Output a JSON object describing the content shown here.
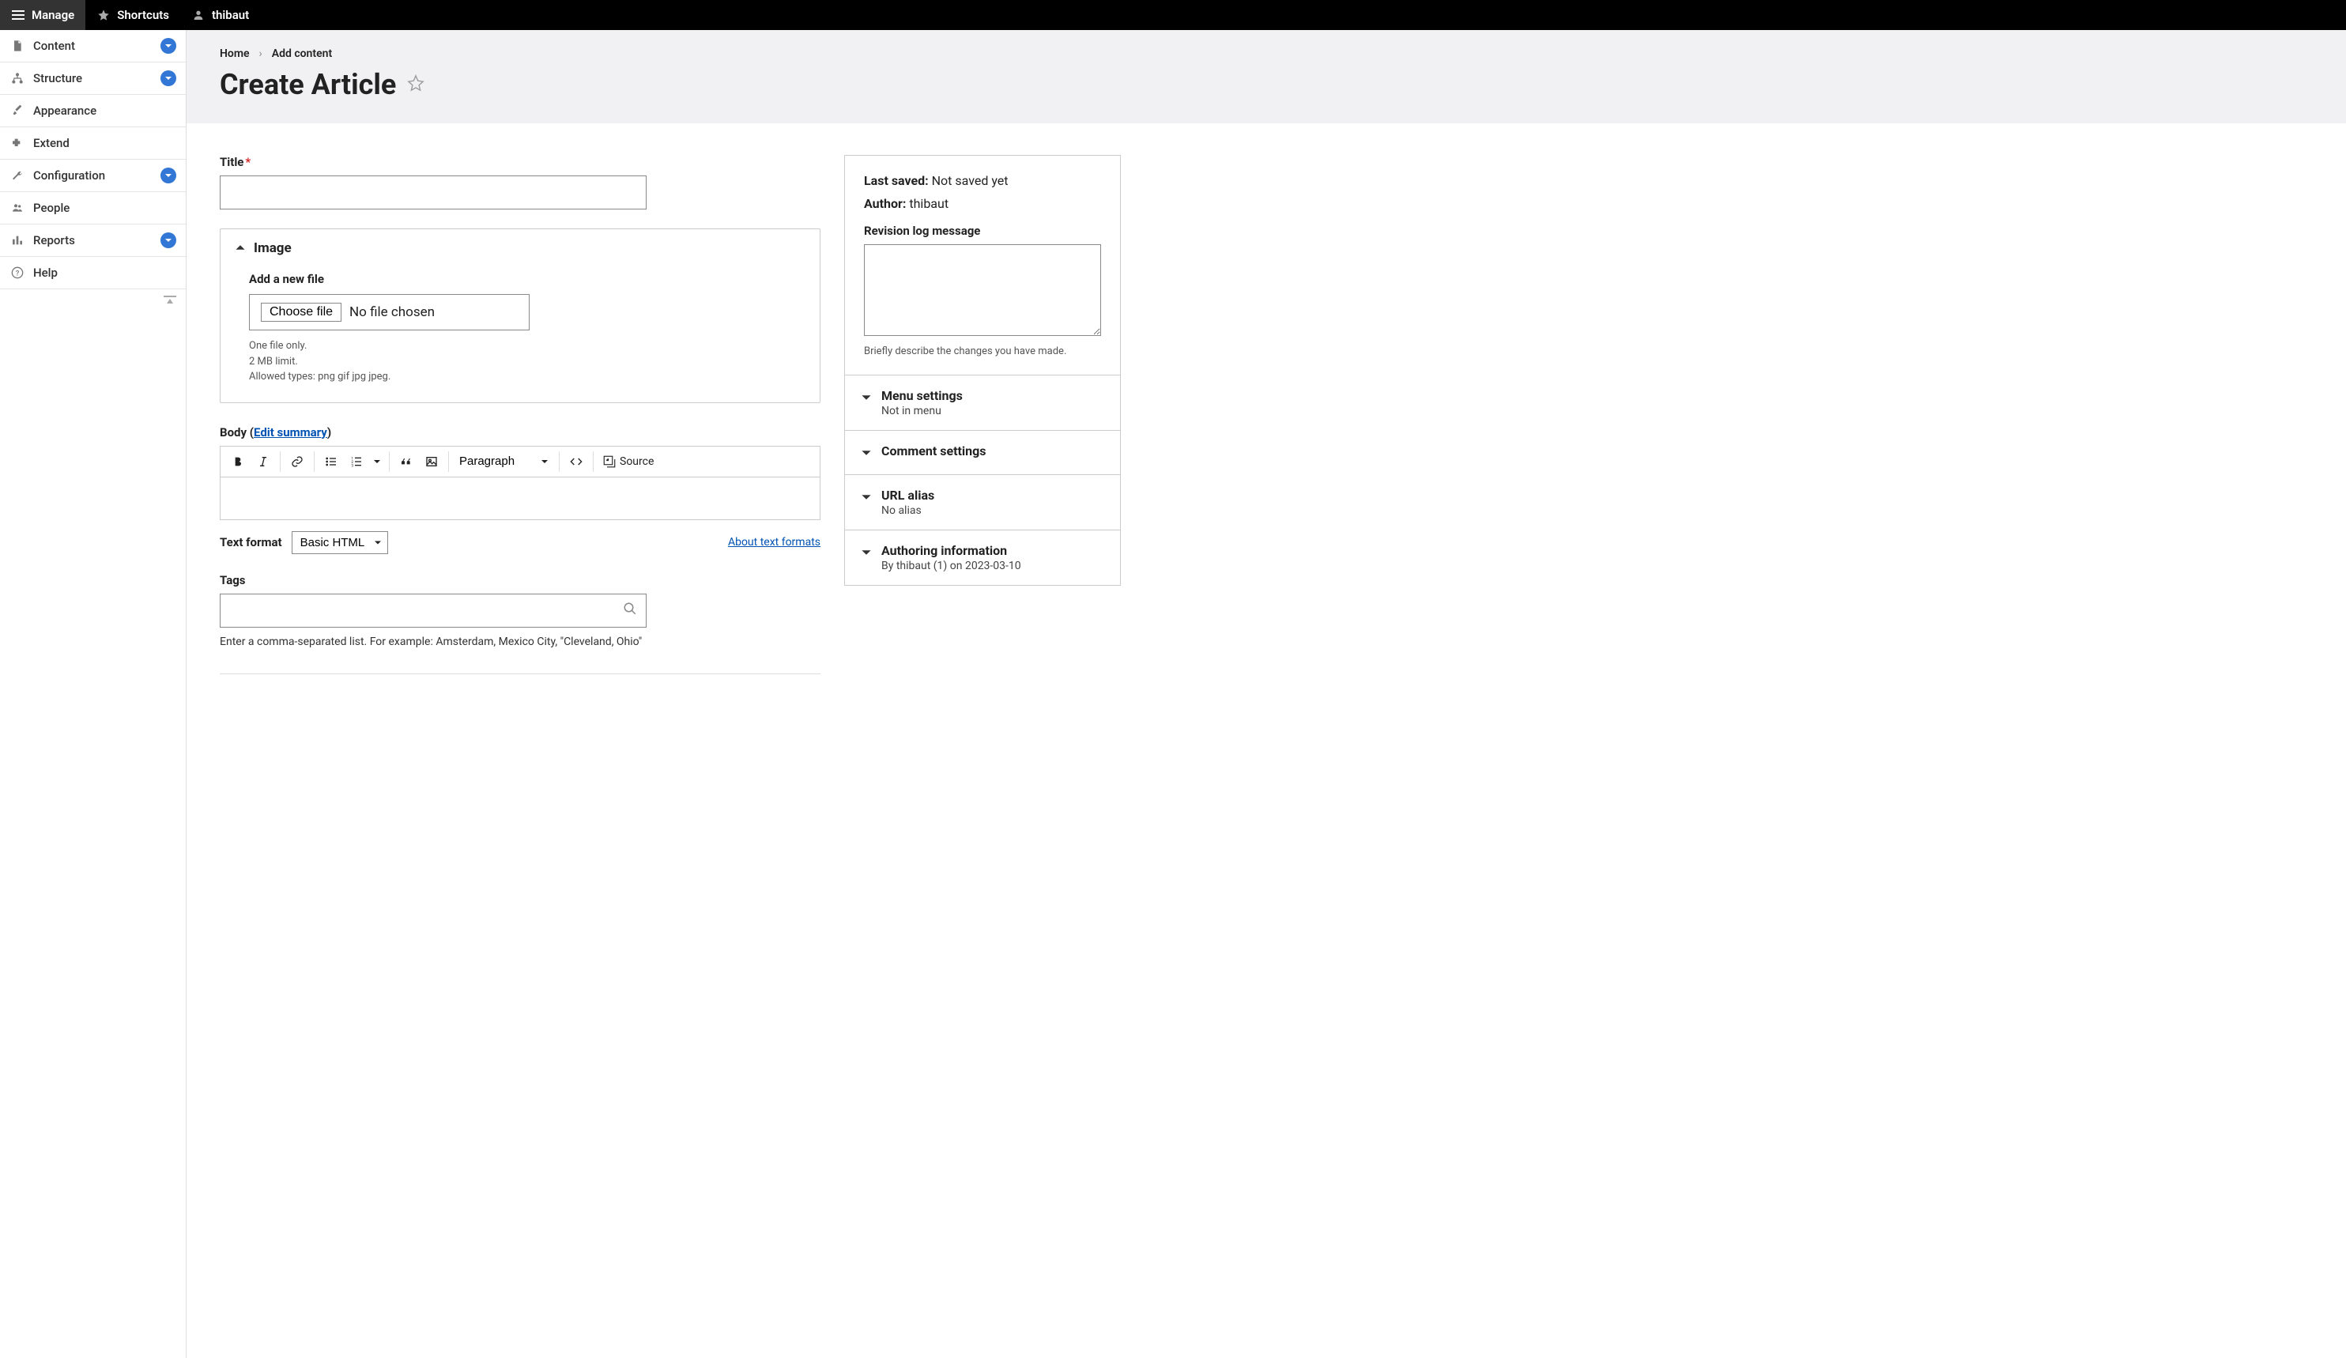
{
  "toolbar": {
    "manage": "Manage",
    "shortcuts": "Shortcuts",
    "user": "thibaut"
  },
  "sidebar": {
    "items": [
      {
        "label": "Content",
        "expandable": true
      },
      {
        "label": "Structure",
        "expandable": true
      },
      {
        "label": "Appearance",
        "expandable": false
      },
      {
        "label": "Extend",
        "expandable": false
      },
      {
        "label": "Configuration",
        "expandable": true
      },
      {
        "label": "People",
        "expandable": false
      },
      {
        "label": "Reports",
        "expandable": true
      },
      {
        "label": "Help",
        "expandable": false
      }
    ]
  },
  "breadcrumb": {
    "home": "Home",
    "add_content": "Add content"
  },
  "page_title": "Create Article",
  "form": {
    "title_label": "Title",
    "title_value": "",
    "image": {
      "legend": "Image",
      "add_file_label": "Add a new file",
      "choose_file": "Choose file",
      "no_file": "No file chosen",
      "help1": "One file only.",
      "help2": "2 MB limit.",
      "help3": "Allowed types: png gif jpg jpeg."
    },
    "body": {
      "label": "Body",
      "edit_summary": "Edit summary",
      "paragraph": "Paragraph",
      "source": "Source",
      "text_format_label": "Text format",
      "text_format_value": "Basic HTML",
      "about_link": "About text formats"
    },
    "tags": {
      "label": "Tags",
      "value": "",
      "help": "Enter a comma-separated list. For example: Amsterdam, Mexico City, \"Cleveland, Ohio\""
    }
  },
  "meta": {
    "last_saved_label": "Last saved:",
    "last_saved_value": "Not saved yet",
    "author_label": "Author:",
    "author_value": "thibaut",
    "revision_label": "Revision log message",
    "revision_value": "",
    "revision_help": "Briefly describe the changes you have made.",
    "sections": [
      {
        "title": "Menu settings",
        "sub": "Not in menu"
      },
      {
        "title": "Comment settings",
        "sub": ""
      },
      {
        "title": "URL alias",
        "sub": "No alias"
      },
      {
        "title": "Authoring information",
        "sub": "By thibaut (1) on 2023-03-10"
      }
    ]
  }
}
